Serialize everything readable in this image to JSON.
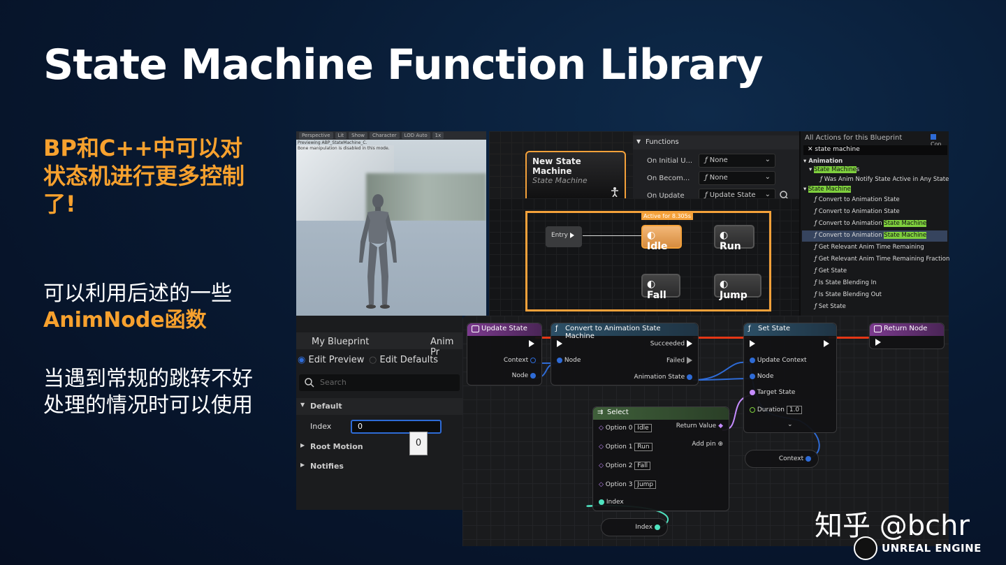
{
  "slide": {
    "title": "State Machine Function Library",
    "p1": "BP和C++中可以对状态机进行更多控制了!",
    "p2_line1": "可以利用后述的一些",
    "p2_line2": "AnimNode函数",
    "p3": "当遇到常规的跳转不好处理的情况时可以使用"
  },
  "viewport": {
    "toolbar": [
      "Perspective",
      "Lit",
      "Show",
      "Character",
      "LOD Auto",
      "1x"
    ],
    "message_line1": "Previewing ABP_StateMachine_C.",
    "message_line2": "Bone manipulation is disabled in this mode."
  },
  "state_machine_node": {
    "title": "New State Machine",
    "subtitle": "State Machine"
  },
  "functions_panel": {
    "header": "Functions",
    "rows": [
      {
        "label": "On Initial U...",
        "value": "None"
      },
      {
        "label": "On Becom...",
        "value": "None"
      },
      {
        "label": "On Update",
        "value": "Update State"
      }
    ]
  },
  "state_graph": {
    "active_tag": "Active for 8.305s",
    "entry": "Entry",
    "states": {
      "idle": "Idle",
      "run": "Run",
      "fall": "Fall",
      "jump": "Jump"
    }
  },
  "actions_panel": {
    "header": "All Actions for this Blueprint",
    "context_label": "Con",
    "search_value": "state machine",
    "items": {
      "animation": "Animation",
      "state_machines_hl": "State Machine",
      "state_machines_tail": "s",
      "was_anim": "Was Anim Notify State Active in Any State",
      "state_machine_cat": "State Machine",
      "convert1": "Convert to Animation State",
      "convert2": "Convert to Animation State",
      "convert3_pre": "Convert to Animation ",
      "convert3_hl": "State Machine",
      "convert4_pre": "Convert to Animation ",
      "convert4_hl": "State Machine",
      "get_relevant1": "Get Relevant Anim Time Remaining",
      "get_relevant2": "Get Relevant Anim Time Remaining Fraction",
      "get_state": "Get State",
      "blending_in": "Is State Blending In",
      "blending_out": "Is State Blending Out",
      "set_state": "Set State"
    }
  },
  "my_blueprint": {
    "tab1": "My Blueprint",
    "tab2": "Anim Pr",
    "edit_preview": "Edit Preview",
    "edit_defaults": "Edit Defaults",
    "search_placeholder": "Search",
    "default_cat": "Default",
    "index_label": "Index",
    "index_value": "0",
    "tooltip_value": "0",
    "root_motion": "Root Motion",
    "notifies": "Notifies"
  },
  "blueprint_graph": {
    "update_state": {
      "title": "Update State",
      "context": "Context",
      "node": "Node"
    },
    "convert": {
      "title": "Convert to Animation State Machine",
      "succeeded": "Succeeded",
      "node": "Node",
      "failed": "Failed",
      "animation_state": "Animation State"
    },
    "set_state": {
      "title": "Set State",
      "update_context": "Update Context",
      "node": "Node",
      "target_state": "Target State",
      "duration": "Duration",
      "duration_value": "1.0"
    },
    "return_node": {
      "title": "Return Node"
    },
    "select": {
      "title": "Select",
      "options": [
        {
          "label": "Option 0",
          "value": "Idle"
        },
        {
          "label": "Option 1",
          "value": "Run"
        },
        {
          "label": "Option 2",
          "value": "Fall"
        },
        {
          "label": "Option 3",
          "value": "Jump"
        }
      ],
      "return_value": "Return Value",
      "add_pin": "Add pin",
      "index": "Index"
    },
    "context_var": "Context",
    "index_var": "Index"
  },
  "watermark": "知乎 @bchr",
  "engine_logo": "UNREAL ENGINE",
  "colors": {
    "accent_orange": "#f7a12e",
    "node_select": "#6bd4a0",
    "exec_wire": "#e53716"
  }
}
